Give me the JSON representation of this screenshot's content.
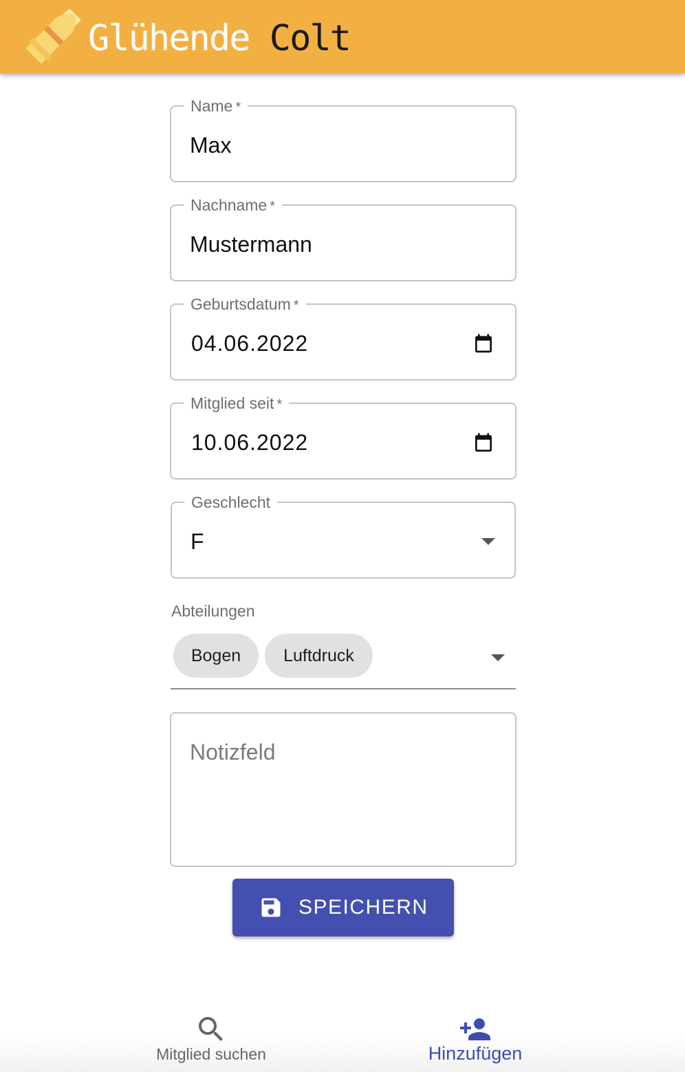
{
  "app": {
    "title_part1": "Glühende",
    "title_part2": "Colt",
    "logo_icon": "bullet-icon",
    "bar_color": "#F3B042"
  },
  "form": {
    "name": {
      "label": "Name",
      "required_mark": "*",
      "value": "Max"
    },
    "nachname": {
      "label": "Nachname",
      "required_mark": "*",
      "value": "Mustermann"
    },
    "geburtsdatum": {
      "label": "Geburtsdatum",
      "required_mark": "*",
      "value": "04.06.2022",
      "icon": "calendar-icon"
    },
    "mitglied_seit": {
      "label": "Mitglied seit",
      "required_mark": "*",
      "value": "10.06.2022",
      "icon": "calendar-icon"
    },
    "geschlecht": {
      "label": "Geschlecht",
      "value": "F",
      "icon": "chevron-down-icon"
    },
    "abteilungen": {
      "label": "Abteilungen",
      "chips": [
        "Bogen",
        "Luftdruck"
      ],
      "icon": "chevron-down-icon"
    },
    "notizfeld": {
      "placeholder": "Notizfeld",
      "value": ""
    }
  },
  "save_button": {
    "label": "SPEICHERN",
    "icon": "save-icon",
    "color": "#4350AF"
  },
  "bottom_nav": {
    "items": [
      {
        "label": "Mitglied suchen",
        "icon": "search-icon",
        "active": false
      },
      {
        "label": "Hinzufügen",
        "icon": "person-add-icon",
        "active": true
      }
    ],
    "active_color": "#3F4DB0"
  }
}
